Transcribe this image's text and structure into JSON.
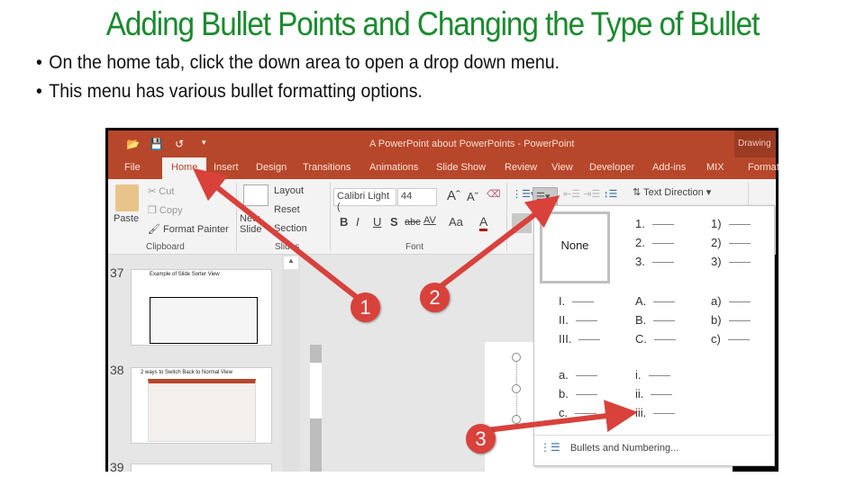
{
  "slide": {
    "title": "Adding Bullet Points and Changing the Type of Bullet",
    "bullets": [
      "On the home tab, click the down area to open a drop down menu.",
      "This menu has various bullet formatting options."
    ]
  },
  "app": {
    "window_title": "A PowerPoint about PowerPoints - PowerPoint",
    "contextual_tab_group": "Drawing",
    "quick_access": [
      "open-icon",
      "save-icon",
      "undo-icon",
      "customize-icon"
    ],
    "tabs": [
      "File",
      "Home",
      "Insert",
      "Design",
      "Transitions",
      "Animations",
      "Slide Show",
      "Review",
      "View",
      "Developer",
      "Add-ins",
      "MIX",
      "Format"
    ],
    "active_tab": "Home",
    "ribbon": {
      "clipboard": {
        "paste": "Paste",
        "cut": "Cut",
        "copy": "Copy",
        "format_painter": "Format Painter",
        "label": "Clipboard"
      },
      "slides": {
        "new_slide": "New Slide",
        "layout": "Layout",
        "reset": "Reset",
        "section": "Section",
        "label": "Slides"
      },
      "font": {
        "font_name": "Calibri Light (",
        "font_size": "44",
        "bold": "B",
        "italic": "I",
        "underline": "U",
        "shadow": "S",
        "strike": "abc",
        "spacing": "AV",
        "case": "Aa",
        "color": "A",
        "label": "Font"
      },
      "paragraph": {
        "text_direction": "Text Direction"
      }
    },
    "thumbnails": [
      {
        "number": "37",
        "title": "Example of Slide Sorter View"
      },
      {
        "number": "38",
        "title": "2 ways to Switch Back to Normal View"
      },
      {
        "number": "39",
        "title": ""
      }
    ],
    "numbering_menu": {
      "none_label": "None",
      "options": [
        [
          "1.",
          "2.",
          "3."
        ],
        [
          "1)",
          "2)",
          "3)"
        ],
        [
          "I.",
          "II.",
          "III."
        ],
        [
          "A.",
          "B.",
          "C."
        ],
        [
          "a)",
          "b)",
          "c)"
        ],
        [
          "a.",
          "b.",
          "c."
        ],
        [
          "i.",
          "ii.",
          "iii."
        ]
      ],
      "footer_item": "Bullets and Numbering..."
    }
  },
  "callouts": [
    "1",
    "2",
    "3"
  ],
  "colors": {
    "title_green": "#1a8a2e",
    "ribbon_accent": "#b7472a",
    "arrow_red": "#d9413b"
  }
}
